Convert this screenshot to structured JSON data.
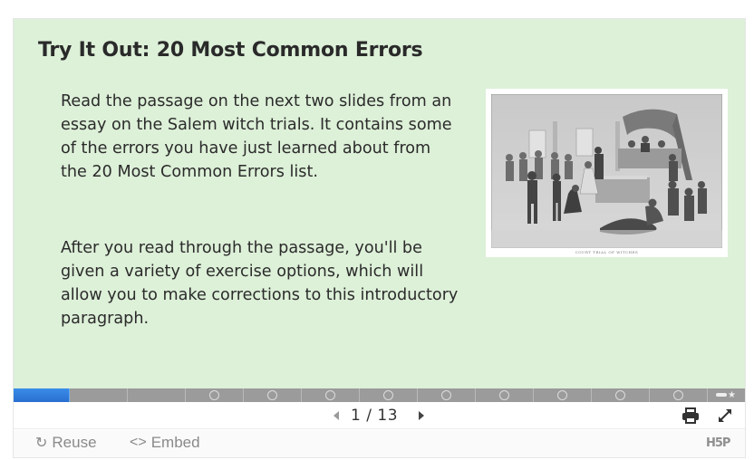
{
  "slide": {
    "title": "Try It Out: 20 Most Common Errors",
    "paragraphs": [
      "Read the passage on the next two slides from an essay on the Salem witch trials. It contains some of the errors you have just learned about from the 20 Most Common Errors list.",
      "After you read through the passage, you'll be given a variety of exercise options, which will allow you to make corrections to this introductory paragraph."
    ],
    "image": {
      "alt": "Engraving of a court trial of witches",
      "caption": "COURT TRIAL OF WITCHES"
    },
    "background_color": "#ddf0d8"
  },
  "progress": {
    "current_slide": 1,
    "total_slides": 13,
    "current_color": "#2f7fe0",
    "segments": [
      {
        "index": 1,
        "state": "current",
        "has_task": false
      },
      {
        "index": 2,
        "state": "unvisited",
        "has_task": false
      },
      {
        "index": 3,
        "state": "unvisited",
        "has_task": false
      },
      {
        "index": 4,
        "state": "unvisited",
        "has_task": true
      },
      {
        "index": 5,
        "state": "unvisited",
        "has_task": true
      },
      {
        "index": 6,
        "state": "unvisited",
        "has_task": true
      },
      {
        "index": 7,
        "state": "unvisited",
        "has_task": true
      },
      {
        "index": 8,
        "state": "unvisited",
        "has_task": true
      },
      {
        "index": 9,
        "state": "unvisited",
        "has_task": true
      },
      {
        "index": 10,
        "state": "unvisited",
        "has_task": true
      },
      {
        "index": 11,
        "state": "unvisited",
        "has_task": true
      },
      {
        "index": 12,
        "state": "unvisited",
        "has_task": true
      },
      {
        "index": 13,
        "state": "summary",
        "has_task": false
      }
    ]
  },
  "navigation": {
    "current": "1",
    "separator": "/",
    "total": "13",
    "prev_icon": "caret-left-icon",
    "next_icon": "caret-right-icon",
    "print_icon": "print-icon",
    "fullscreen_icon": "fullscreen-icon"
  },
  "footer": {
    "reuse_label": "Reuse",
    "reuse_icon": "refresh-icon",
    "embed_label": "Embed",
    "embed_icon": "code-icon",
    "embed_glyph": "<>",
    "logo_text": "H5P"
  }
}
